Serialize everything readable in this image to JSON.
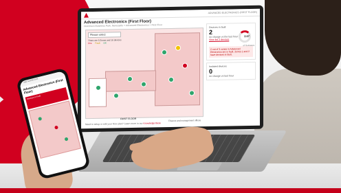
{
  "laptop": {
    "topbar_right": "ADVANCED ELECTRONICS (FIRST FLOOR)",
    "title": "Advanced Electronics (First Floor)",
    "breadcrumb": "Hutchison Business Park, Newcastle > Advanced Electronics > First Floor",
    "select_placeholder": "Please select",
    "legend_text": "There are 3 Zones and 16 devices",
    "legend_items": [
      "Fire",
      "Fault",
      "OK"
    ],
    "floor_label": "FIRST FLOOR",
    "mgmt_label": "Finance and management offices",
    "bottom_note_prefix": "Need to setup or edit your floor plan? Learn more in our",
    "bottom_note_link": "Knowledge Base",
    "panel": {
      "devices_in_fault_title": "Devices in fault",
      "fault_count": "2",
      "fault_sub": "no change vs the last hour",
      "view_link": "View list 2 devices",
      "ring_value": "2.67",
      "ring_unit": "of 75 devices",
      "warning_text": "2 out of 3 zones in Advanced Electronics are in fault. Zones 1 and 2 have devices in fault.",
      "isolated_title": "Isolated devices",
      "isolated_count": "0",
      "isolated_sub": "no change vs last hour"
    }
  },
  "phone": {
    "url": "app.hochiki.com",
    "title": "Advanced Electronics (First Floor)",
    "warning": "Devices in fault"
  },
  "colors": {
    "brand_red": "#d1001f",
    "ok_green": "#2fa56c",
    "fault_yellow": "#f2c300",
    "zone_pink": "#f3c9c9"
  }
}
